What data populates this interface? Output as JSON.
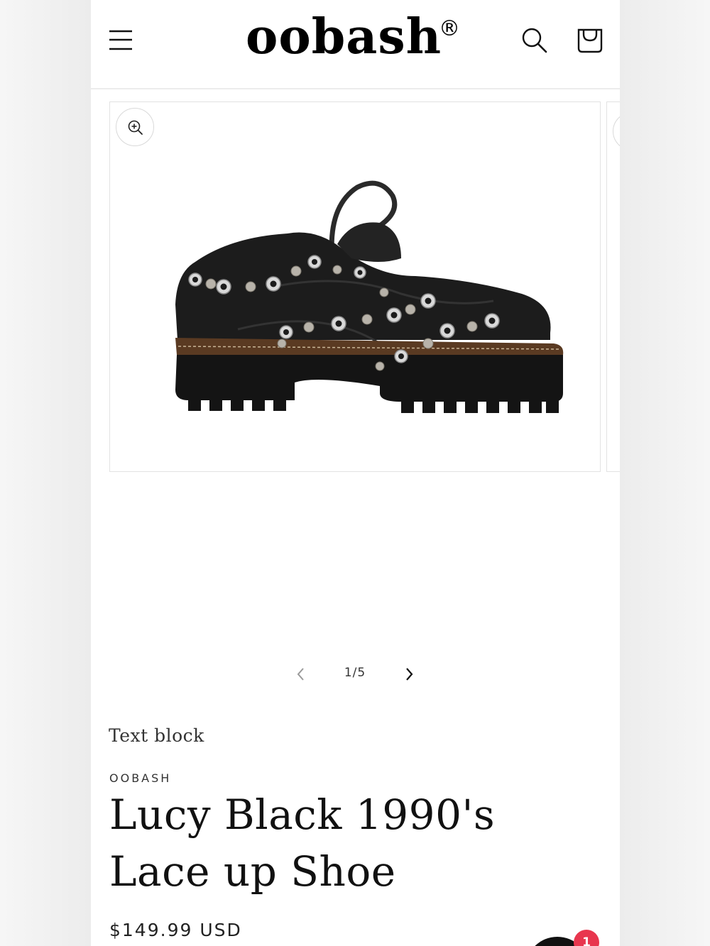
{
  "header": {
    "logo_text": "oobash",
    "logo_mark": "®",
    "icons": [
      "hamburger-menu-icon",
      "search-icon",
      "cart-icon"
    ]
  },
  "gallery": {
    "zoom_icon": "zoom-in-icon",
    "counter": "1/5",
    "prev_icon": "chevron-left-icon",
    "next_icon": "chevron-right-icon"
  },
  "product": {
    "text_block": "Text block",
    "vendor": "OOBASH",
    "title": "Lucy Black 1990's Lace up Shoe",
    "price": "$149.99 USD"
  },
  "chat": {
    "badge_count": "1"
  },
  "colors": {
    "accent_badge": "#e8364e",
    "text": "#111111",
    "border": "#e2e2e2"
  }
}
